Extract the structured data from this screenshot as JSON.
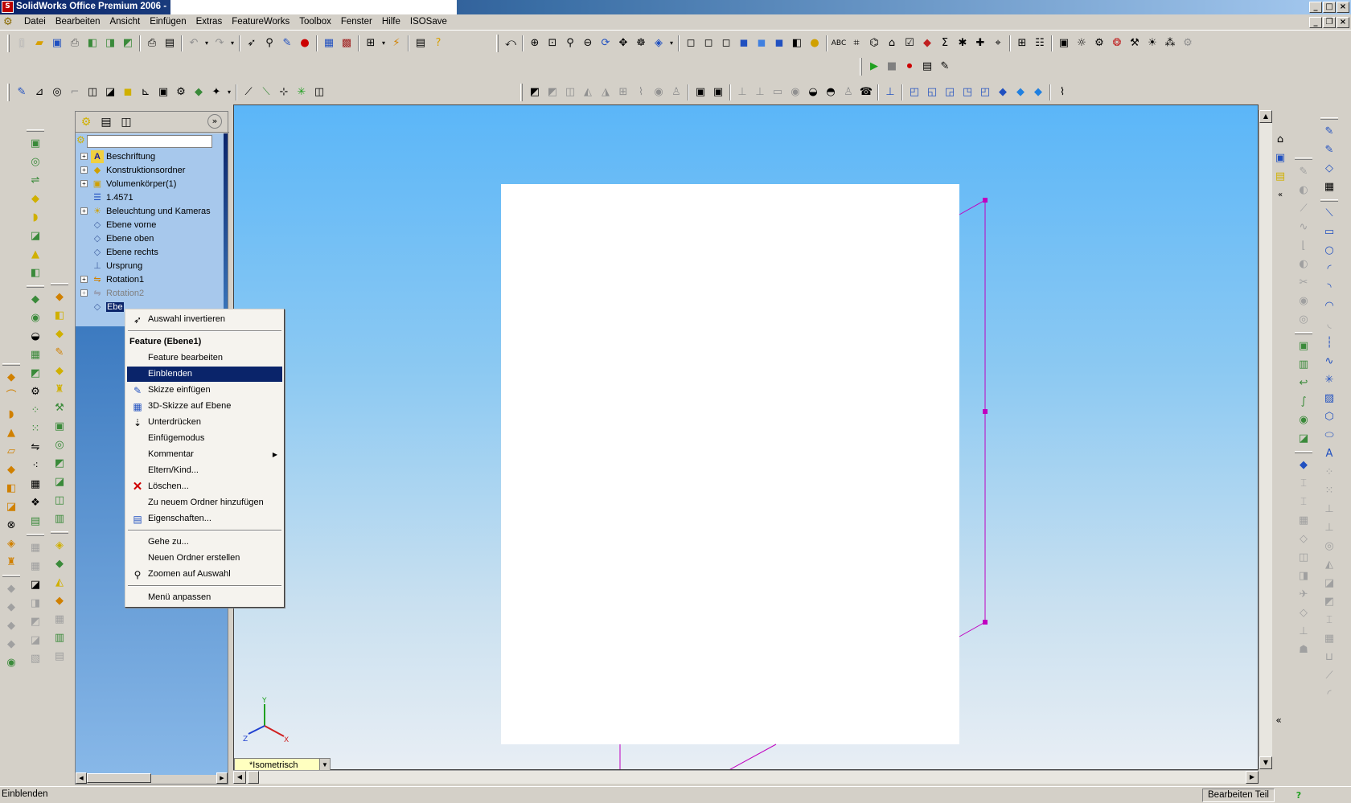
{
  "window": {
    "title": "SolidWorks Office Premium 2006 -"
  },
  "menu": [
    "Datei",
    "Bearbeiten",
    "Ansicht",
    "Einfügen",
    "Extras",
    "FeatureWorks",
    "Toolbox",
    "Fenster",
    "Hilfe",
    "ISOSave"
  ],
  "tree": {
    "items": [
      {
        "label": "Beschriftung",
        "icon": "annotation-icon",
        "expand": "+"
      },
      {
        "label": "Konstruktionsordner",
        "icon": "design-folder-icon",
        "expand": "+"
      },
      {
        "label": "Volumenkörper(1)",
        "icon": "solid-body-icon",
        "expand": "+"
      },
      {
        "label": "1.4571",
        "icon": "material-icon",
        "expand": ""
      },
      {
        "label": "Beleuchtung und Kameras",
        "icon": "lights-icon",
        "expand": "+"
      },
      {
        "label": "Ebene vorne",
        "icon": "plane-icon",
        "expand": ""
      },
      {
        "label": "Ebene oben",
        "icon": "plane-icon",
        "expand": ""
      },
      {
        "label": "Ebene rechts",
        "icon": "plane-icon",
        "expand": ""
      },
      {
        "label": "Ursprung",
        "icon": "origin-icon",
        "expand": ""
      },
      {
        "label": "Rotation1",
        "icon": "revolve-icon",
        "expand": "+"
      },
      {
        "label": "Rotation2",
        "icon": "revolve-icon",
        "expand": "+",
        "disabled": true
      },
      {
        "label": "Ebe",
        "icon": "plane-icon",
        "expand": "",
        "selected": true
      }
    ]
  },
  "context_menu": {
    "invert": "Auswahl invertieren",
    "header": "Feature (Ebene1)",
    "edit_feature": "Feature bearbeiten",
    "show": "Einblenden",
    "insert_sketch": "Skizze einfügen",
    "sketch3d": "3D-Skizze auf Ebene",
    "suppress": "Unterdrücken",
    "insert_mode": "Einfügemodus",
    "comment": "Kommentar",
    "parent_child": "Eltern/Kind...",
    "delete": "Löschen...",
    "add_folder": "Zu neuem Ordner hinzufügen",
    "properties": "Eigenschaften...",
    "goto": "Gehe zu...",
    "new_folder": "Neuen Ordner erstellen",
    "zoom_selection": "Zoomen auf Auswahl",
    "customize": "Menü anpassen"
  },
  "view_selector": "*Isometrisch",
  "status": {
    "message": "Einblenden",
    "mode": "Bearbeiten Teil"
  },
  "colors": {
    "plane": "#c000c0",
    "highlight": "#0a246a",
    "viewport_top": "#5bb6f8",
    "viewport_bottom": "#e8eef4"
  }
}
